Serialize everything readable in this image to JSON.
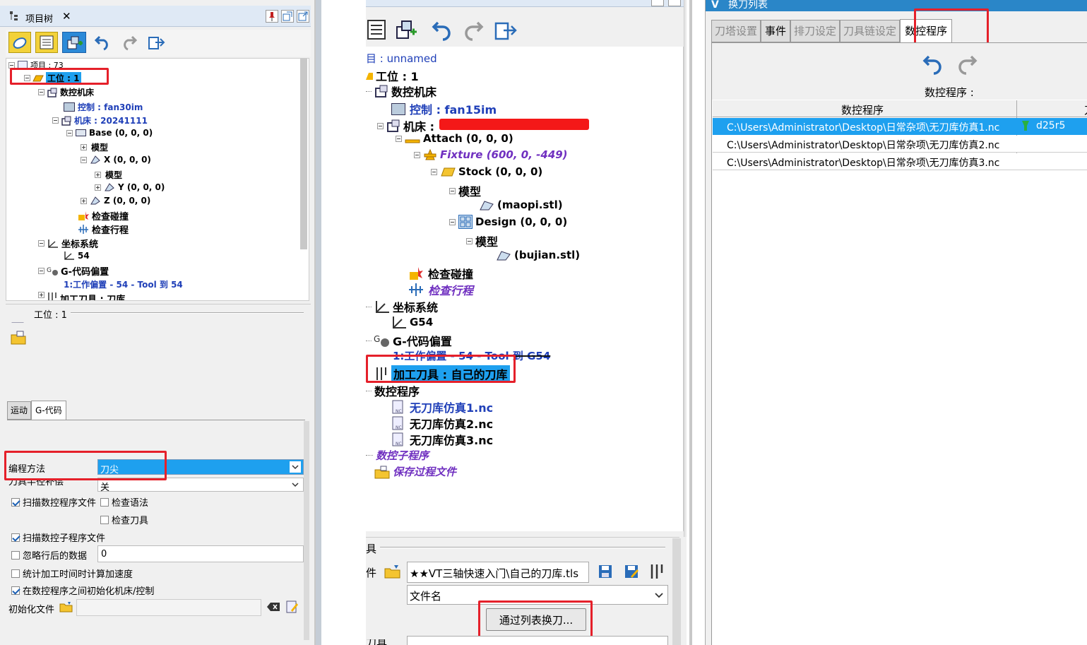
{
  "left": {
    "title": "项目树",
    "close": "✕",
    "tree": [
      {
        "label": "项目 : 73"
      },
      {
        "label": "工位 : 1"
      },
      {
        "label": "数控机床"
      },
      {
        "label": "控制 : fan30im"
      },
      {
        "label": "机床 : 20241111"
      },
      {
        "label": "Base (0, 0, 0)"
      },
      {
        "label": "模型"
      },
      {
        "label": "X (0, 0, 0)"
      },
      {
        "label": "模型"
      },
      {
        "label": "Y (0, 0, 0)"
      },
      {
        "label": "Z (0, 0, 0)"
      },
      {
        "label": "检查碰撞"
      },
      {
        "label": "检查行程"
      },
      {
        "label": "坐标系统"
      },
      {
        "label": "54"
      },
      {
        "label": "G-代码偏置"
      },
      {
        "label": "1:工作偏置 - 54 - Tool 到 54"
      },
      {
        "label": "加工刀具 : 刀库"
      }
    ],
    "section_title": "工位 : 1",
    "tabs": [
      "运动",
      "G-代码"
    ],
    "fields": {
      "prog_method_label": "编程方法",
      "prog_method_value": "刀尖",
      "comp_label": "刀具半径补偿",
      "comp_value": "关",
      "scan_nc": "扫描数控程序文件",
      "check_syntax": "检查语法",
      "check_tool": "检查刀具",
      "scan_sub": "扫描数控子程序文件",
      "ignore_after": "忽略行后的数据",
      "ignore_value": "0",
      "stat_time": "统计加工时间时计算加速度",
      "init_between": "在数控程序之间初始化机床/控制",
      "init_file": "初始化文件"
    }
  },
  "middle": {
    "tree": [
      {
        "label": "目 : unnamed"
      },
      {
        "label": "工位 : 1"
      },
      {
        "label": "数控机床"
      },
      {
        "label": "控制 : fan15im"
      },
      {
        "label": "机床 :"
      },
      {
        "label": "Attach (0, 0, 0)"
      },
      {
        "label": "Fixture (600, 0, -449)"
      },
      {
        "label": "Stock (0, 0, 0)"
      },
      {
        "label": "模型"
      },
      {
        "label": "(maopi.stl)"
      },
      {
        "label": "Design (0, 0, 0)"
      },
      {
        "label": "模型"
      },
      {
        "label": "(bujian.stl)"
      },
      {
        "label": "检查碰撞"
      },
      {
        "label": "检查行程"
      },
      {
        "label": "坐标系统"
      },
      {
        "label": "G54"
      },
      {
        "label": "G-代码偏置"
      },
      {
        "label": "1:工作偏置 - 54 - Tool 到 G54"
      },
      {
        "label": "加工刀具 : 自己的刀库"
      },
      {
        "label": "数控程序"
      },
      {
        "label": "无刀库仿真1.nc"
      },
      {
        "label": "无刀库仿真2.nc"
      },
      {
        "label": "无刀库仿真3.nc"
      },
      {
        "label": "数控子程序"
      },
      {
        "label": "保存过程文件"
      }
    ],
    "bottom_title": "具",
    "file_label": "件",
    "file_value": "★★VT三轴快速入门\\自己的刀库.tls",
    "file_name": "文件名",
    "change_button": "通过列表换刀...",
    "tool_label": "刀具"
  },
  "right": {
    "title": "换刀列表",
    "tabs": [
      "刀塔设置",
      "事件",
      "排刀设定",
      "刀具链设定",
      "数控程序"
    ],
    "section": "数控程序 :",
    "col1": "数控程序",
    "col2": "刀",
    "rows": [
      {
        "path": "C:\\Users\\Administrator\\Desktop\\日常杂项\\无刀库仿真1.nc",
        "tool": "d25r5"
      },
      {
        "path": "C:\\Users\\Administrator\\Desktop\\日常杂项\\无刀库仿真2.nc",
        "tool": ""
      },
      {
        "path": "C:\\Users\\Administrator\\Desktop\\日常杂项\\无刀库仿真3.nc",
        "tool": ""
      }
    ]
  },
  "colors": {
    "highlight": "#1ea0ef",
    "red": "#e5202a",
    "title_blue": "#2a86c8"
  }
}
